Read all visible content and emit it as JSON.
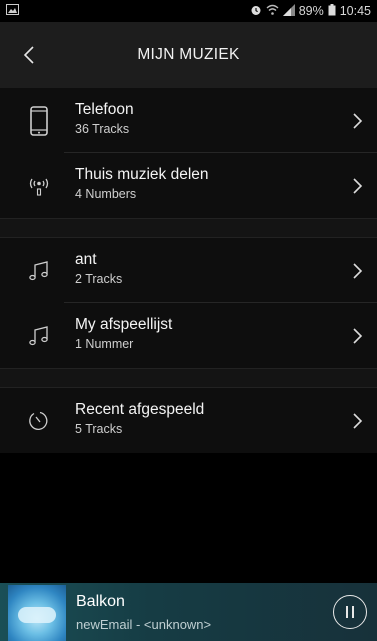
{
  "status_bar": {
    "battery_percent": "89%",
    "time": "10:45"
  },
  "header": {
    "title": "MIJN MUZIEK"
  },
  "sections": [
    {
      "items": [
        {
          "name": "Telefoon",
          "sub": "36 Tracks",
          "icon": "phone-icon"
        },
        {
          "name": "Thuis muziek delen",
          "sub": "4 Numbers",
          "icon": "wireless-share-icon"
        }
      ]
    },
    {
      "items": [
        {
          "name": "ant",
          "sub": "2 Tracks",
          "icon": "music-note-icon"
        },
        {
          "name": "My afspeellijst",
          "sub": "1 Nummer",
          "icon": "music-note-icon"
        }
      ]
    },
    {
      "items": [
        {
          "name": "Recent afgespeeld",
          "sub": "5 Tracks",
          "icon": "clock-icon"
        }
      ]
    }
  ],
  "now_playing": {
    "title": "Balkon",
    "artist": "newEmail - <unknown>"
  }
}
